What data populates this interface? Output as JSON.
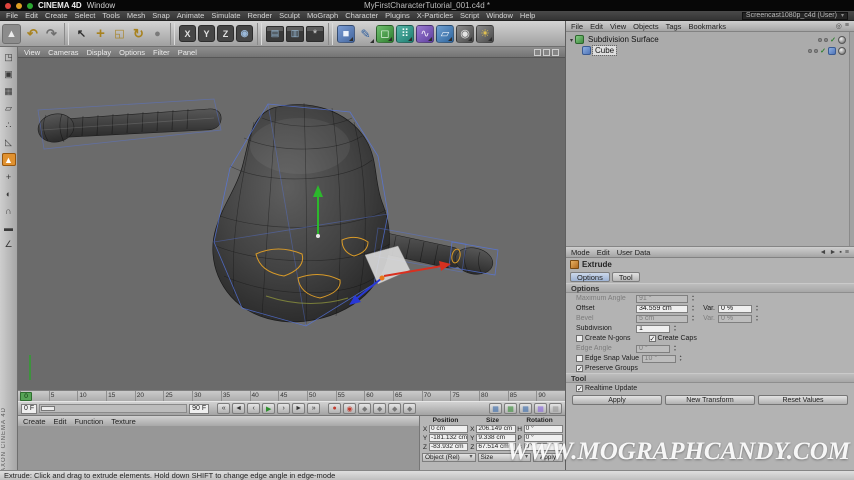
{
  "macos_bar": {
    "app_name": "CINEMA 4D",
    "menu": "Window",
    "window_title": "MyFirstCharacterTutorial_001.c4d *"
  },
  "menubar": {
    "items": [
      "File",
      "Edit",
      "Create",
      "Select",
      "Tools",
      "Mesh",
      "Snap",
      "Animate",
      "Simulate",
      "Render",
      "Sculpt",
      "MoGraph",
      "Character",
      "Plugins",
      "X-Particles",
      "Script",
      "Window",
      "Help"
    ],
    "layout_value": "Screencast1080p_c4d (User)"
  },
  "toolbar": {
    "icons": [
      {
        "name": "active-tool-extrude-icon",
        "glyph": "▲",
        "cls": "tbi boxed",
        "style": "color:#ececec",
        "inter": "true"
      },
      {
        "name": "undo-icon",
        "glyph": "↶",
        "cls": "tbi",
        "style": "color:#a8821f;font-weight:bold;font-size:13px",
        "inter": "true"
      },
      {
        "name": "redo-icon",
        "glyph": "↷",
        "cls": "tbi",
        "style": "color:#6f6f6f;font-weight:bold;font-size:13px",
        "inter": "true"
      },
      {
        "name": "toolbar-separator",
        "glyph": "",
        "cls": "tbsep",
        "style": "",
        "inter": "false"
      },
      {
        "name": "live-selection-icon",
        "glyph": "↖",
        "cls": "tbi",
        "style": "color:#2e2e2e;font-weight:bold",
        "inter": "true"
      },
      {
        "name": "move-tool-icon",
        "glyph": "+",
        "cls": "tbi",
        "style": "color:#a8821f;font-weight:900;font-size:15px",
        "inter": "true"
      },
      {
        "name": "scale-tool-icon",
        "glyph": "◱",
        "cls": "tbi",
        "style": "color:#a8821f",
        "inter": "true"
      },
      {
        "name": "rotate-tool-icon",
        "glyph": "↻",
        "cls": "tbi",
        "style": "color:#a8821f;font-weight:bold;font-size:13px",
        "inter": "true"
      },
      {
        "name": "last-tool-icon",
        "glyph": "●",
        "cls": "tbi",
        "style": "color:#7a7a7a",
        "inter": "true"
      },
      {
        "name": "toolbar-separator",
        "glyph": "",
        "cls": "tbsep",
        "style": "",
        "inter": "false"
      },
      {
        "name": "lock-x-axis-button",
        "glyph": "X",
        "cls": "tbi dark",
        "style": "",
        "inter": "true"
      },
      {
        "name": "lock-y-axis-button",
        "glyph": "Y",
        "cls": "tbi dark",
        "style": "",
        "inter": "true"
      },
      {
        "name": "lock-z-axis-button",
        "glyph": "Z",
        "cls": "tbi dark",
        "style": "",
        "inter": "true"
      },
      {
        "name": "coordinate-system-button",
        "glyph": "◉",
        "cls": "tbi dark",
        "style": "color:#9ab8d8",
        "inter": "true"
      },
      {
        "name": "toolbar-separator",
        "glyph": "",
        "cls": "tbsep",
        "style": "",
        "inter": "false"
      },
      {
        "name": "render-view-button",
        "glyph": "▤",
        "cls": "tbi clap",
        "style": "",
        "inter": "true"
      },
      {
        "name": "render-picture-viewer-button",
        "glyph": "▥",
        "cls": "tbi clap",
        "style": "",
        "inter": "true"
      },
      {
        "name": "render-settings-button",
        "glyph": "*",
        "cls": "tbi clap",
        "style": "color:#d8d8d8;font-size:11px",
        "inter": "true"
      },
      {
        "name": "toolbar-separator",
        "glyph": "",
        "cls": "tbsep",
        "style": "",
        "inter": "false"
      },
      {
        "name": "add-primitive-cube-button",
        "glyph": "■",
        "cls": "tbi dd prim",
        "style": "",
        "inter": "true"
      },
      {
        "name": "add-spline-pen-button",
        "glyph": "✎",
        "cls": "tbi dd",
        "style": "color:#2f5f9f;font-size:12px",
        "inter": "true"
      },
      {
        "name": "add-subdivision-surface-button",
        "glyph": "◻",
        "cls": "tbi dd gen",
        "style": "",
        "inter": "true"
      },
      {
        "name": "add-array-button",
        "glyph": "⠿",
        "cls": "tbi dd arr",
        "style": "",
        "inter": "true"
      },
      {
        "name": "add-deformer-button",
        "glyph": "∿",
        "cls": "tbi dd def",
        "style": "",
        "inter": "true"
      },
      {
        "name": "add-environment-button",
        "glyph": "▱",
        "cls": "tbi dd env",
        "style": "",
        "inter": "true"
      },
      {
        "name": "add-camera-button",
        "glyph": "◉",
        "cls": "tbi dd cam",
        "style": "",
        "inter": "true"
      },
      {
        "name": "add-light-button",
        "glyph": "☀",
        "cls": "tbi dd cam",
        "style": "color:#e0c050",
        "inter": "true"
      }
    ]
  },
  "left_toolbar": {
    "icons": [
      {
        "name": "make-editable-icon",
        "glyph": "◳",
        "cls": "lbi",
        "inter": "true"
      },
      {
        "name": "model-mode-icon",
        "glyph": "▣",
        "cls": "lbi",
        "inter": "true"
      },
      {
        "name": "texture-mode-icon",
        "glyph": "▦",
        "cls": "lbi",
        "inter": "true"
      },
      {
        "name": "workplane-mode-icon",
        "glyph": "▱",
        "cls": "lbi",
        "inter": "true"
      },
      {
        "name": "points-mode-icon",
        "glyph": "∴",
        "cls": "lbi",
        "inter": "true"
      },
      {
        "name": "edges-mode-icon",
        "glyph": "◺",
        "cls": "lbi",
        "inter": "true"
      },
      {
        "name": "polygons-mode-icon",
        "glyph": "▲",
        "cls": "lbi active",
        "inter": "true"
      },
      {
        "name": "enable-axis-icon",
        "glyph": "+",
        "cls": "lbi",
        "inter": "true"
      },
      {
        "name": "viewport-solo-icon",
        "glyph": "◐",
        "cls": "lbi",
        "inter": "true"
      },
      {
        "name": "snap-enable-icon",
        "glyph": "∩",
        "cls": "lbi",
        "inter": "true"
      },
      {
        "name": "workplane-lock-icon",
        "glyph": "▬",
        "cls": "lbi",
        "inter": "true"
      },
      {
        "name": "quantize-icon",
        "glyph": "∠",
        "cls": "lbi",
        "inter": "true"
      }
    ]
  },
  "viewport": {
    "menus": [
      "View",
      "Cameras",
      "Display",
      "Options",
      "Filter",
      "Panel"
    ],
    "pane_icons": [
      {
        "name": "viewport-pane-toggle-icon-1"
      },
      {
        "name": "viewport-pane-toggle-icon-2"
      },
      {
        "name": "viewport-pane-toggle-icon-3"
      }
    ]
  },
  "object_manager": {
    "menus": [
      "File",
      "Edit",
      "View",
      "Objects",
      "Tags",
      "Bookmarks"
    ],
    "corner_icons": [
      {
        "name": "om-search-icon",
        "glyph": "◎"
      },
      {
        "name": "om-options-icon",
        "glyph": "≡"
      }
    ],
    "enabled_glyph": "✓",
    "objects": [
      {
        "name": "Subdivision Surface"
      },
      {
        "name": "Cube"
      }
    ]
  },
  "attributes": {
    "menus": [
      "Mode",
      "Edit",
      "User Data"
    ],
    "corner_icons": [
      {
        "name": "history-back-icon",
        "glyph": "◄"
      },
      {
        "name": "history-forward-icon",
        "glyph": "►"
      },
      {
        "name": "lock-icon",
        "glyph": "▪"
      },
      {
        "name": "am-options-icon",
        "glyph": "≡"
      }
    ],
    "tool_title": "Extrude",
    "tabs": [
      "Options",
      "Tool"
    ],
    "options_section": "Options",
    "maximum_angle_label": "Maximum Angle",
    "maximum_angle_value": "91 °",
    "offset_label": "Offset",
    "offset_value": "34.559 cm",
    "var_label": "Var.",
    "offset_var_value": "0 %",
    "bevel_label": "Bevel",
    "bevel_value": "5 cm",
    "bevel_var_value": "0 %",
    "subdivision_label": "Subdivision",
    "subdivision_value": "1",
    "create_ngons_label": "Create N-gons",
    "create_caps_label": "Create Caps",
    "edge_angle_label": "Edge Angle",
    "edge_angle_value": "0 °",
    "edge_snap_label": "Edge Snap",
    "snap_value_label": "Value",
    "snap_value_value": "10 °",
    "preserve_groups_label": "Preserve Groups",
    "tool_section": "Tool",
    "realtime_update_label": "Realtime Update",
    "apply_label": "Apply",
    "new_transform_label": "New Transform",
    "reset_values_label": "Reset Values"
  },
  "timeline": {
    "ticks": [
      "0",
      "5",
      "10",
      "15",
      "20",
      "25",
      "30",
      "35",
      "40",
      "45",
      "50",
      "55",
      "60",
      "65",
      "70",
      "75",
      "80",
      "85",
      "90"
    ],
    "playhead": "0"
  },
  "playbar": {
    "current_frame": "0 F",
    "end_frame": "90 F",
    "transport": [
      {
        "name": "goto-start-button",
        "glyph": "«",
        "cls": "pbtn",
        "style": "",
        "inter": "true"
      },
      {
        "name": "prev-key-button",
        "glyph": "◄",
        "cls": "pbtn",
        "style": "",
        "inter": "true"
      },
      {
        "name": "prev-frame-button",
        "glyph": "‹",
        "cls": "pbtn",
        "style": "",
        "inter": "true"
      },
      {
        "name": "play-button",
        "glyph": "▶",
        "cls": "pbtn",
        "style": "color:#2e8f2e",
        "inter": "true"
      },
      {
        "name": "next-frame-button",
        "glyph": "›",
        "cls": "pbtn",
        "style": "",
        "inter": "true"
      },
      {
        "name": "next-key-button",
        "glyph": "►",
        "cls": "pbtn",
        "style": "",
        "inter": "true"
      },
      {
        "name": "goto-end-button",
        "glyph": "»",
        "cls": "pbtn",
        "style": "",
        "inter": "true"
      }
    ],
    "record": [
      {
        "name": "record-keyframe-button",
        "glyph": "●",
        "cls": "pbtn",
        "style": "color:#c23b2e",
        "inter": "true"
      },
      {
        "name": "autokeying-button",
        "glyph": "◉",
        "cls": "pbtn",
        "style": "color:#c23b2e",
        "inter": "true"
      },
      {
        "name": "record-position-toggle",
        "glyph": "◆",
        "cls": "pbtn",
        "style": "color:#777",
        "inter": "true"
      },
      {
        "name": "record-scale-toggle",
        "glyph": "◆",
        "cls": "pbtn",
        "style": "color:#777",
        "inter": "true"
      },
      {
        "name": "record-rotation-toggle",
        "glyph": "◆",
        "cls": "pbtn",
        "style": "color:#777",
        "inter": "true"
      },
      {
        "name": "record-parameter-toggle",
        "glyph": "◆",
        "cls": "pbtn",
        "style": "color:#777",
        "inter": "true"
      }
    ],
    "options": [
      {
        "name": "playbar-option-icon-1",
        "glyph": "▦",
        "cls": "pbtn",
        "style": "color:#3f6fae",
        "inter": "true"
      },
      {
        "name": "playbar-option-icon-2",
        "glyph": "▦",
        "cls": "pbtn",
        "style": "color:#3f8f3f",
        "inter": "true"
      },
      {
        "name": "playbar-option-icon-3",
        "glyph": "▦",
        "cls": "pbtn",
        "style": "color:#3f6fae",
        "inter": "true"
      },
      {
        "name": "playbar-option-icon-4",
        "glyph": "▦",
        "cls": "pbtn",
        "style": "color:#8a6adb",
        "inter": "true"
      },
      {
        "name": "playbar-option-icon-5",
        "glyph": "▦",
        "cls": "pbtn",
        "style": "color:#9a9a9a",
        "inter": "true"
      }
    ]
  },
  "material_manager": {
    "menus": [
      "Create",
      "Edit",
      "Function",
      "Texture"
    ]
  },
  "coordinates": {
    "headers": [
      "Position",
      "Size",
      "Rotation"
    ],
    "rows": [
      {
        "pl": "X",
        "pv": "0 cm",
        "sl": "X",
        "sv": "206.149 cm",
        "rl": "H",
        "rv": "0 °"
      },
      {
        "pl": "Y",
        "pv": "-181.132 cm",
        "sl": "Y",
        "sv": "9.338 cm",
        "rl": "P",
        "rv": "0 °"
      },
      {
        "pl": "Z",
        "pv": "-83.932 cm",
        "sl": "Z",
        "sv": "67.514 cm",
        "rl": "B",
        "rv": "0 °"
      }
    ],
    "mode_dropdown": "Object (Rel)",
    "size_dropdown": "Size",
    "apply_label": "Apply"
  },
  "statusbar": {
    "text": "Extrude: Click and drag to extrude elements. Hold down SHIFT to change edge angle in edge-mode"
  },
  "watermark": {
    "text": "WWW.MOGRAPHCANDY.COM"
  },
  "brand": {
    "text": "MAXON CINEMA 4D"
  },
  "colors": {
    "selection_orange": "#d89a28",
    "cage_blue": "#5577e8",
    "axis_x_red": "#d83020",
    "axis_y_green": "#2cb82c",
    "axis_z_blue": "#2838d8",
    "viewport_bg": "#6b6b6b",
    "mode_highlight_orange": "#e0912f"
  }
}
